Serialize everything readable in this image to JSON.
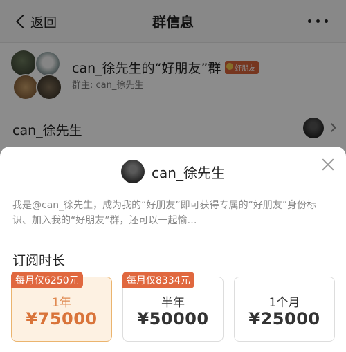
{
  "nav": {
    "back_label": "返回",
    "title": "群信息"
  },
  "group": {
    "name": "can_徐先生的“好朋友”群",
    "badge": "好朋友",
    "owner_line": "群主: can_徐先生"
  },
  "owner_row": {
    "name": "can_徐先生"
  },
  "sheet": {
    "title": "can_徐先生",
    "description": "我是@can_徐先生，成为我的“好朋友”即可获得专属的“好朋友”身份标识、加入我的“好朋友”群，还可以一起愉…",
    "section_title": "订阅时长",
    "plans": [
      {
        "tag": "每月仅6250元",
        "name": "1年",
        "price": "¥75000",
        "selected": true
      },
      {
        "tag": "每月仅8334元",
        "name": "半年",
        "price": "¥50000",
        "selected": false
      },
      {
        "tag": "",
        "name": "1个月",
        "price": "¥25000",
        "selected": false
      }
    ]
  },
  "colors": {
    "accent": "#e0683f",
    "selected_bg": "#fdf1e2",
    "selected_border": "#ebb46e"
  }
}
